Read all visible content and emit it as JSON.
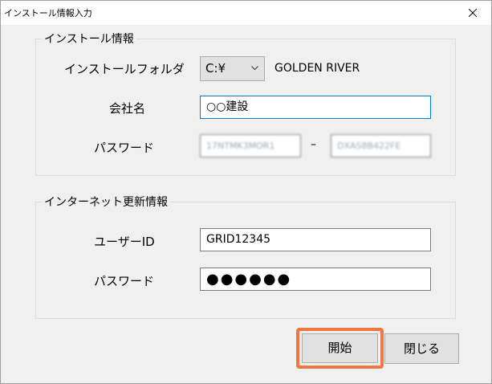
{
  "window": {
    "title": "インストール情報入力",
    "close_icon": "close-icon"
  },
  "install_info": {
    "legend": "インストール情報",
    "folder_label": "インストールフォルダ",
    "drive_value": "C:¥",
    "folder_name": "GOLDEN RIVER",
    "company_label": "会社名",
    "company_value": "○○建設",
    "password_label": "パスワード",
    "password_part1": "17NTMK3MOR1",
    "password_separator": "–",
    "password_part2": "DXAS8B422FE"
  },
  "update_info": {
    "legend": "インターネット更新情報",
    "user_id_label": "ユーザーID",
    "user_id_value": "GRID12345",
    "password_label": "パスワード",
    "password_value": "●●●●●●"
  },
  "buttons": {
    "start": "開始",
    "close": "閉じる"
  },
  "colors": {
    "highlight": "#f07840",
    "focus_border": "#0078d7",
    "dialog_bg": "#f0f0f0"
  }
}
